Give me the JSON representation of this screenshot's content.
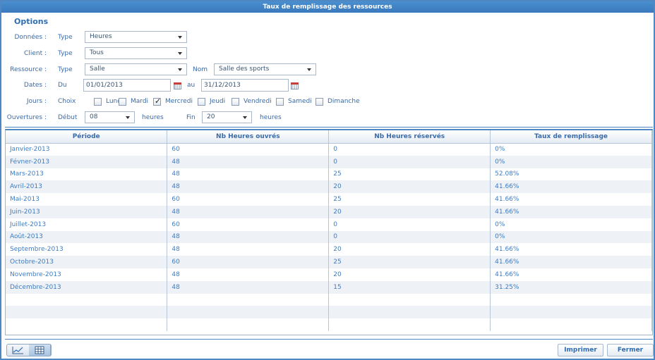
{
  "window": {
    "title": "Taux de remplissage des ressources"
  },
  "options": {
    "title": "Options",
    "donnees": {
      "label": "Données :",
      "type_label": "Type",
      "value": "Heures"
    },
    "client": {
      "label": "Client :",
      "type_label": "Type",
      "value": "Tous"
    },
    "ressource": {
      "label": "Ressource :",
      "type_label": "Type",
      "value": "Salle",
      "nom_label": "Nom",
      "nom_value": "Salle des sports"
    },
    "dates": {
      "label": "Dates :",
      "du_label": "Du",
      "du_value": "01/01/2013",
      "au_label": "au",
      "au_value": "31/12/2013"
    },
    "jours": {
      "label": "Jours :",
      "choix_label": "Choix",
      "days": [
        {
          "name": "Lundi",
          "checked": false
        },
        {
          "name": "Mardi",
          "checked": false
        },
        {
          "name": "Mercredi",
          "checked": true
        },
        {
          "name": "Jeudi",
          "checked": false
        },
        {
          "name": "Vendredi",
          "checked": false
        },
        {
          "name": "Samedi",
          "checked": false
        },
        {
          "name": "Dimanche",
          "checked": false
        }
      ]
    },
    "ouvertures": {
      "label": "Ouvertures :",
      "debut_label": "Début",
      "debut_value": "08",
      "heures1": "heures",
      "fin_label": "Fin",
      "fin_value": "20",
      "heures2": "heures"
    }
  },
  "table": {
    "columns": [
      "Période",
      "Nb Heures ouvrés",
      "Nb Heures réservés",
      "Taux de remplissage"
    ],
    "rows": [
      [
        "Janvier-2013",
        "60",
        "0",
        "0%"
      ],
      [
        "Févner-2013",
        "48",
        "0",
        "0%"
      ],
      [
        "Mars-2013",
        "48",
        "25",
        "52.08%"
      ],
      [
        "Avril-2013",
        "48",
        "20",
        "41.66%"
      ],
      [
        "Mai-2013",
        "60",
        "25",
        "41.66%"
      ],
      [
        "Juin-2013",
        "48",
        "20",
        "41.66%"
      ],
      [
        "Juillet-2013",
        "60",
        "0",
        "0%"
      ],
      [
        "Août-2013",
        "48",
        "0",
        "0%"
      ],
      [
        "Septembre-2013",
        "48",
        "20",
        "41.66%"
      ],
      [
        "Octobre-2013",
        "60",
        "25",
        "41.66%"
      ],
      [
        "Novembre-2013",
        "48",
        "20",
        "41.66%"
      ],
      [
        "Décembre-2013",
        "48",
        "15",
        "31.25%"
      ]
    ],
    "empty_rows": 3
  },
  "footer": {
    "view_chart_icon": "line-chart-icon",
    "view_grid_icon": "grid-icon",
    "print_label": "Imprimer",
    "close_label": "Fermer"
  }
}
